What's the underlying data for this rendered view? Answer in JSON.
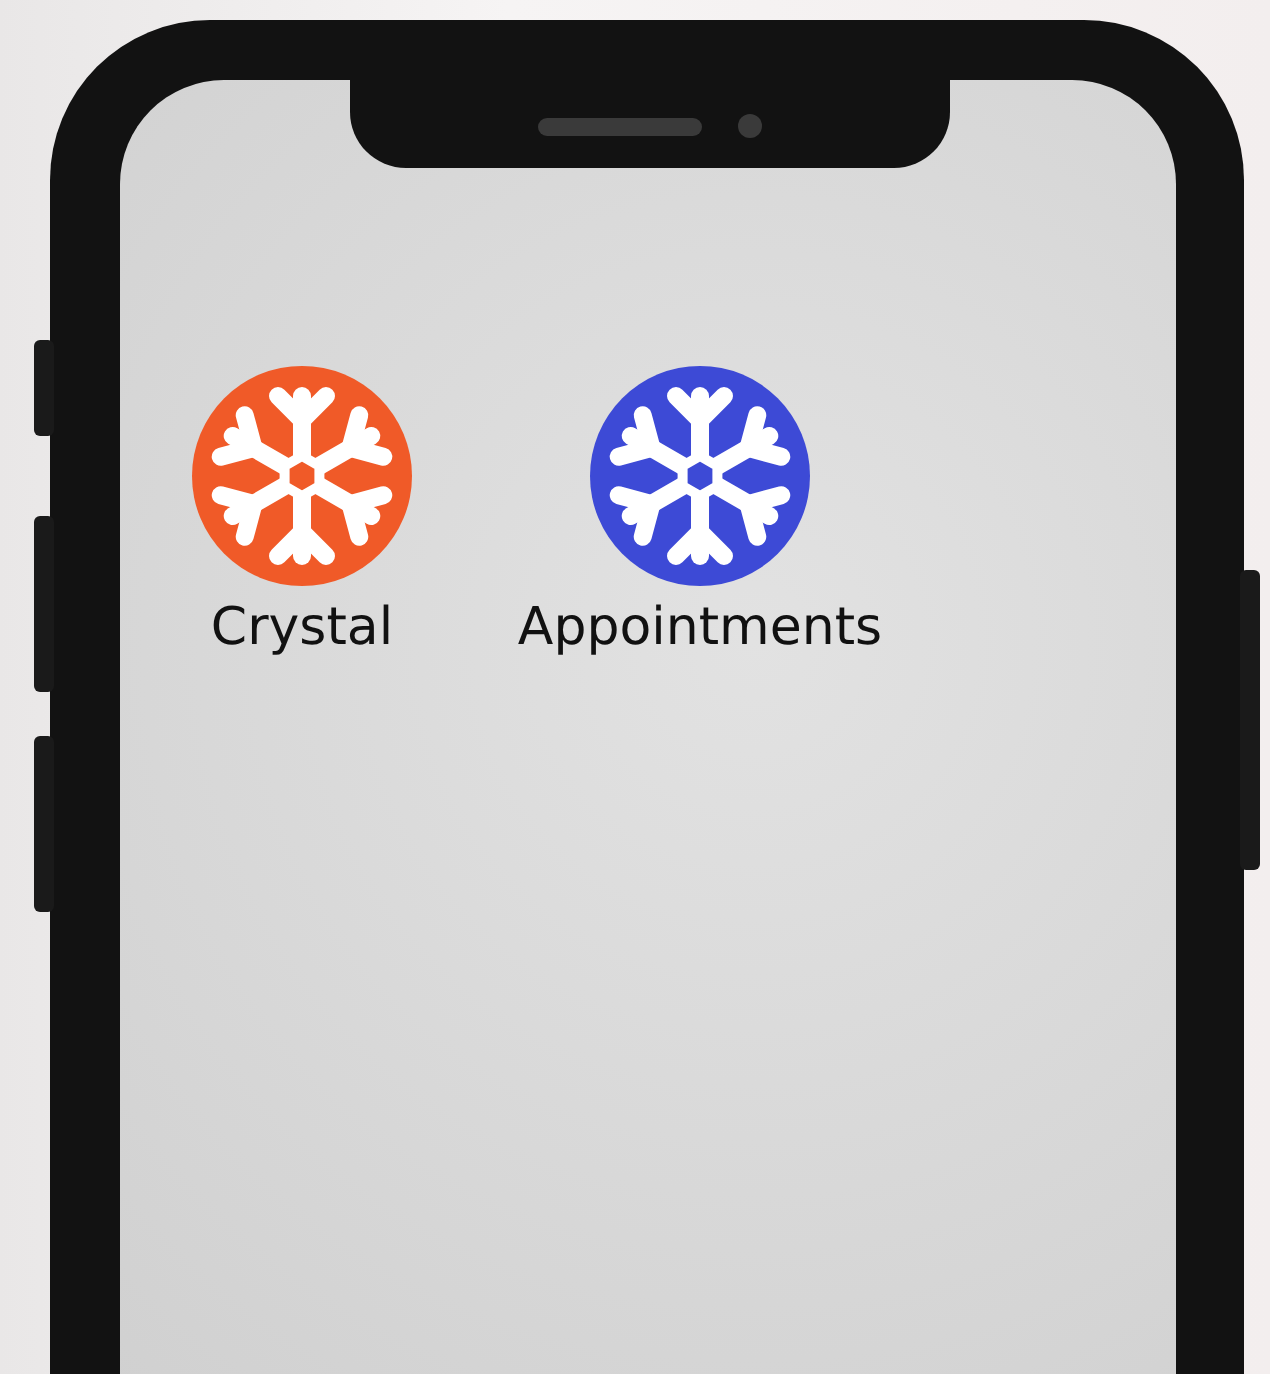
{
  "apps": [
    {
      "label": "Crystal",
      "color": "#f05a28"
    },
    {
      "label": "Appointments",
      "color": "#3d4ad6"
    }
  ]
}
